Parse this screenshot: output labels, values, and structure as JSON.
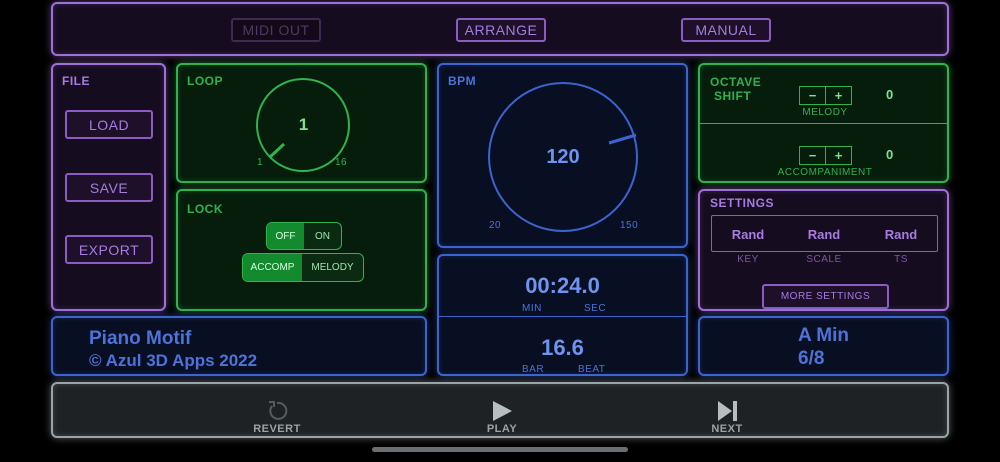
{
  "top_bar": {
    "midi_out": "MIDI OUT",
    "arrange": "ARRANGE",
    "manual": "MANUAL"
  },
  "file": {
    "title": "FILE",
    "load": "LOAD",
    "save": "SAVE",
    "export": "EXPORT"
  },
  "loop": {
    "title": "LOOP",
    "value": "1",
    "min": "1",
    "max": "16"
  },
  "lock": {
    "title": "LOCK",
    "off": "OFF",
    "on": "ON",
    "accomp": "ACCOMP",
    "melody": "MELODY"
  },
  "bpm": {
    "title": "BPM",
    "value": "120",
    "min": "20",
    "max": "150"
  },
  "octave_shift": {
    "title_line1": "OCTAVE",
    "title_line2": "SHIFT",
    "minus": "−",
    "plus": "+",
    "melody_label": "MELODY",
    "melody_value": "0",
    "accompaniment_label": "ACCOMPANIMENT",
    "accompaniment_value": "0"
  },
  "settings": {
    "title": "SETTINGS",
    "key_value": "Rand",
    "scale_value": "Rand",
    "ts_value": "Rand",
    "key_label": "KEY",
    "scale_label": "SCALE",
    "ts_label": "TS",
    "more_settings": "MORE SETTINGS"
  },
  "song": {
    "title": "Piano Motif",
    "copyright": "© Azul 3D Apps 2022"
  },
  "time": {
    "value": "00:24.0",
    "min_label": "MIN",
    "sec_label": "SEC"
  },
  "position": {
    "value": "16.6",
    "bar_label": "BAR",
    "beat_label": "BEAT"
  },
  "key_info": {
    "key": "A Min",
    "time_signature": "6/8"
  },
  "controls": {
    "revert": "REVERT",
    "play": "PLAY",
    "next": "NEXT"
  },
  "colors": {
    "purple": "#a070d8",
    "green": "#2fb34e",
    "blue": "#3d63cf",
    "gray": "#9aa3a6"
  }
}
